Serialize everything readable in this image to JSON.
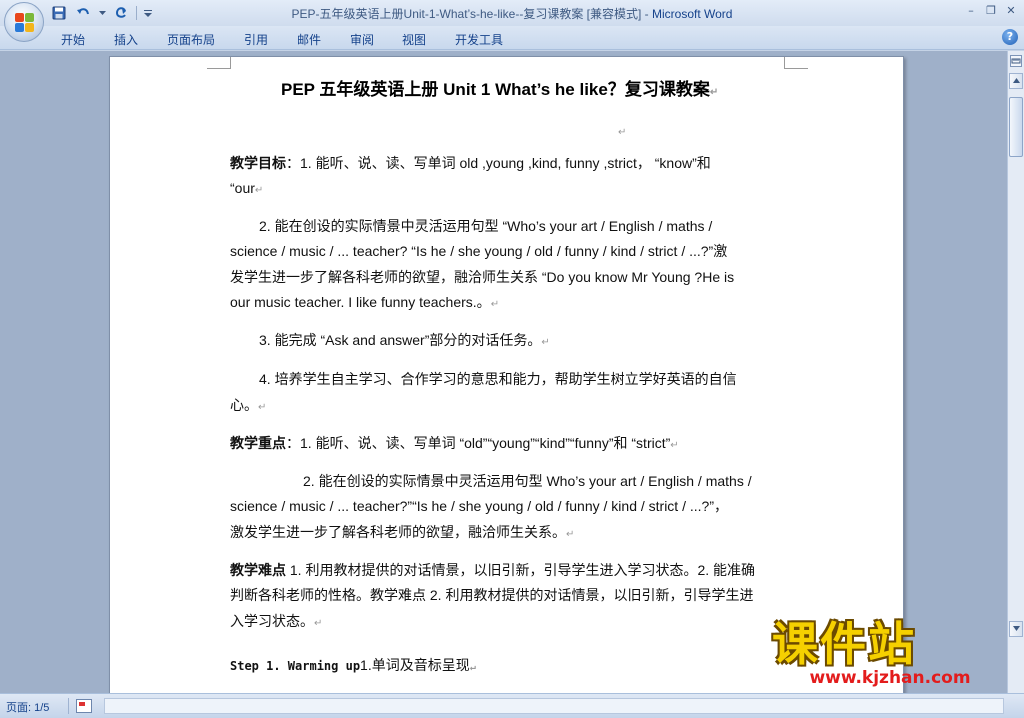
{
  "window": {
    "title": "PEP-五年级英语上册Unit-1-What’s-he-like--复习课教案 [兼容模式] - ",
    "app_name": "Microsoft Word",
    "minimize": "–",
    "restore": "❐",
    "close": "✕"
  },
  "ribbon": {
    "tabs": [
      "开始",
      "插入",
      "页面布局",
      "引用",
      "邮件",
      "审阅",
      "视图",
      "开发工具"
    ],
    "help": "?"
  },
  "document": {
    "title": "PEP 五年级英语上册 Unit 1 What’s he like？复习课教案",
    "para_mark": "↵",
    "objectives_label": "教学目标",
    "objectives_line1": "：1. 能听、说、读、写单词 old ,young ,kind, funny ,strict， “know”和",
    "objectives_line2": "“our",
    "obj2_line1": "2. 能在创设的实际情景中灵活运用句型 “Who’s your art / English / maths /",
    "obj2_line2": "science / music / ... teacher? “Is he / she young / old / funny / kind / strict / ...?”激",
    "obj2_line3": "发学生进一步了解各科老师的欲望，融洽师生关系 “Do you know Mr Young ?He is",
    "obj2_line4": "our music teacher. I like funny teachers.。",
    "obj3": "3. 能完成 “Ask and answer”部分的对话任务。",
    "obj4_line1": "4. 培养学生自主学习、合作学习的意思和能力，帮助学生树立学好英语的自信",
    "obj4_line2": "心。",
    "key_label": "教学重点",
    "key_line1": "：1. 能听、说、读、写单词 “old”“young”“kind”“funny”和 “strict”",
    "key2_line1": "2. 能在创设的实际情景中灵活运用句型 Who’s your art / English / maths /",
    "key2_line2": "science / music / ... teacher?”“Is he / she young / old / funny / kind / strict / ...?”，",
    "key2_line3": "激发学生进一步了解各科老师的欲望，融洽师生关系。",
    "difficulty_label": "教学难点",
    "difficulty_line1": " 1. 利用教材提供的对话情景，以旧引新，引导学生进入学习状态。2. 能准确",
    "difficulty_line2": "判断各科老师的性格。教学难点 2. 利用教材提供的对话情景，以旧引新，引导学生进",
    "difficulty_line3": "入学习状态。",
    "step1_label": "Step 1. Warming up",
    "step1_text": "1.单词及音标呈现"
  },
  "watermark": {
    "logo": "课件站",
    "url": "www.kjzhan.com"
  },
  "statusbar": {
    "page_indicator": "页面: 1/5"
  },
  "colors": {
    "ribbon_text": "#15428b",
    "chrome_bg": "#c5d3e6",
    "watermark_yellow": "#f5d000",
    "watermark_red": "#e31c1c"
  }
}
